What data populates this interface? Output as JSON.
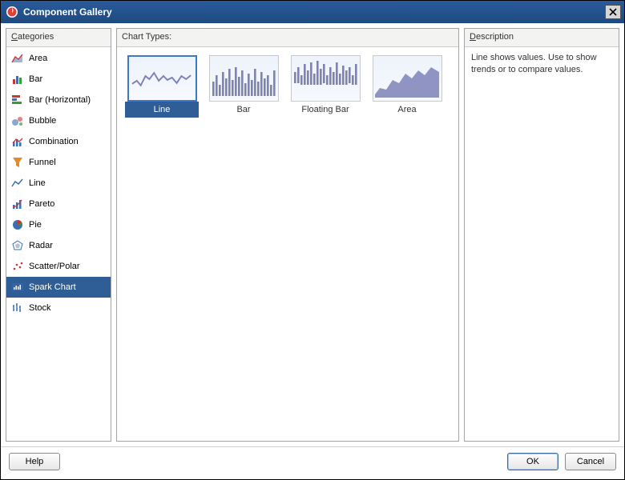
{
  "window": {
    "title": "Component Gallery"
  },
  "panels": {
    "categories_label": "Categories",
    "chart_types_label": "Chart Types:",
    "description_label": "Description"
  },
  "categories": {
    "selected": "Spark Chart",
    "items": [
      {
        "label": "Area",
        "icon": "area-icon"
      },
      {
        "label": "Bar",
        "icon": "bar-icon"
      },
      {
        "label": "Bar (Horizontal)",
        "icon": "bar-horizontal-icon"
      },
      {
        "label": "Bubble",
        "icon": "bubble-icon"
      },
      {
        "label": "Combination",
        "icon": "combination-icon"
      },
      {
        "label": "Funnel",
        "icon": "funnel-icon"
      },
      {
        "label": "Line",
        "icon": "line-icon"
      },
      {
        "label": "Pareto",
        "icon": "pareto-icon"
      },
      {
        "label": "Pie",
        "icon": "pie-icon"
      },
      {
        "label": "Radar",
        "icon": "radar-icon"
      },
      {
        "label": "Scatter/Polar",
        "icon": "scatter-icon"
      },
      {
        "label": "Spark Chart",
        "icon": "spark-icon"
      },
      {
        "label": "Stock",
        "icon": "stock-icon"
      }
    ]
  },
  "chart_types": {
    "selected": "Line",
    "items": [
      {
        "label": "Line",
        "preview": "spark-line"
      },
      {
        "label": "Bar",
        "preview": "spark-bar"
      },
      {
        "label": "Floating Bar",
        "preview": "spark-floatingbar"
      },
      {
        "label": "Area",
        "preview": "spark-area"
      }
    ]
  },
  "description": {
    "text": "Line shows values. Use to show trends or to compare values."
  },
  "buttons": {
    "help": "Help",
    "ok": "OK",
    "cancel": "Cancel"
  },
  "colors": {
    "accent": "#2f5d96",
    "spark_fill": "#7d82b8"
  }
}
